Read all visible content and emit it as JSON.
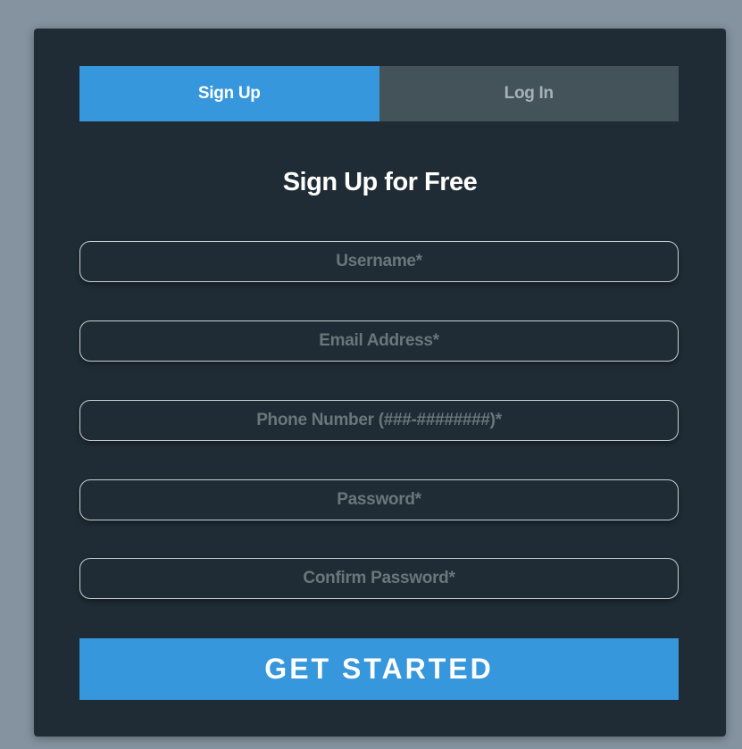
{
  "tabs": {
    "signup_label": "Sign Up",
    "login_label": "Log In"
  },
  "form": {
    "title": "Sign Up for Free",
    "fields": [
      {
        "placeholder": "Username*",
        "value": ""
      },
      {
        "placeholder": "Email Address*",
        "value": ""
      },
      {
        "placeholder": "Phone Number (###-########)*",
        "value": ""
      },
      {
        "placeholder": "Password*",
        "value": ""
      },
      {
        "placeholder": "Confirm Password*",
        "value": ""
      }
    ],
    "submit_label": "GET STARTED"
  },
  "colors": {
    "page_background": "#8593a0",
    "card_background": "#1f2c35",
    "accent": "#3697dd",
    "inactive_tab": "#435359"
  }
}
